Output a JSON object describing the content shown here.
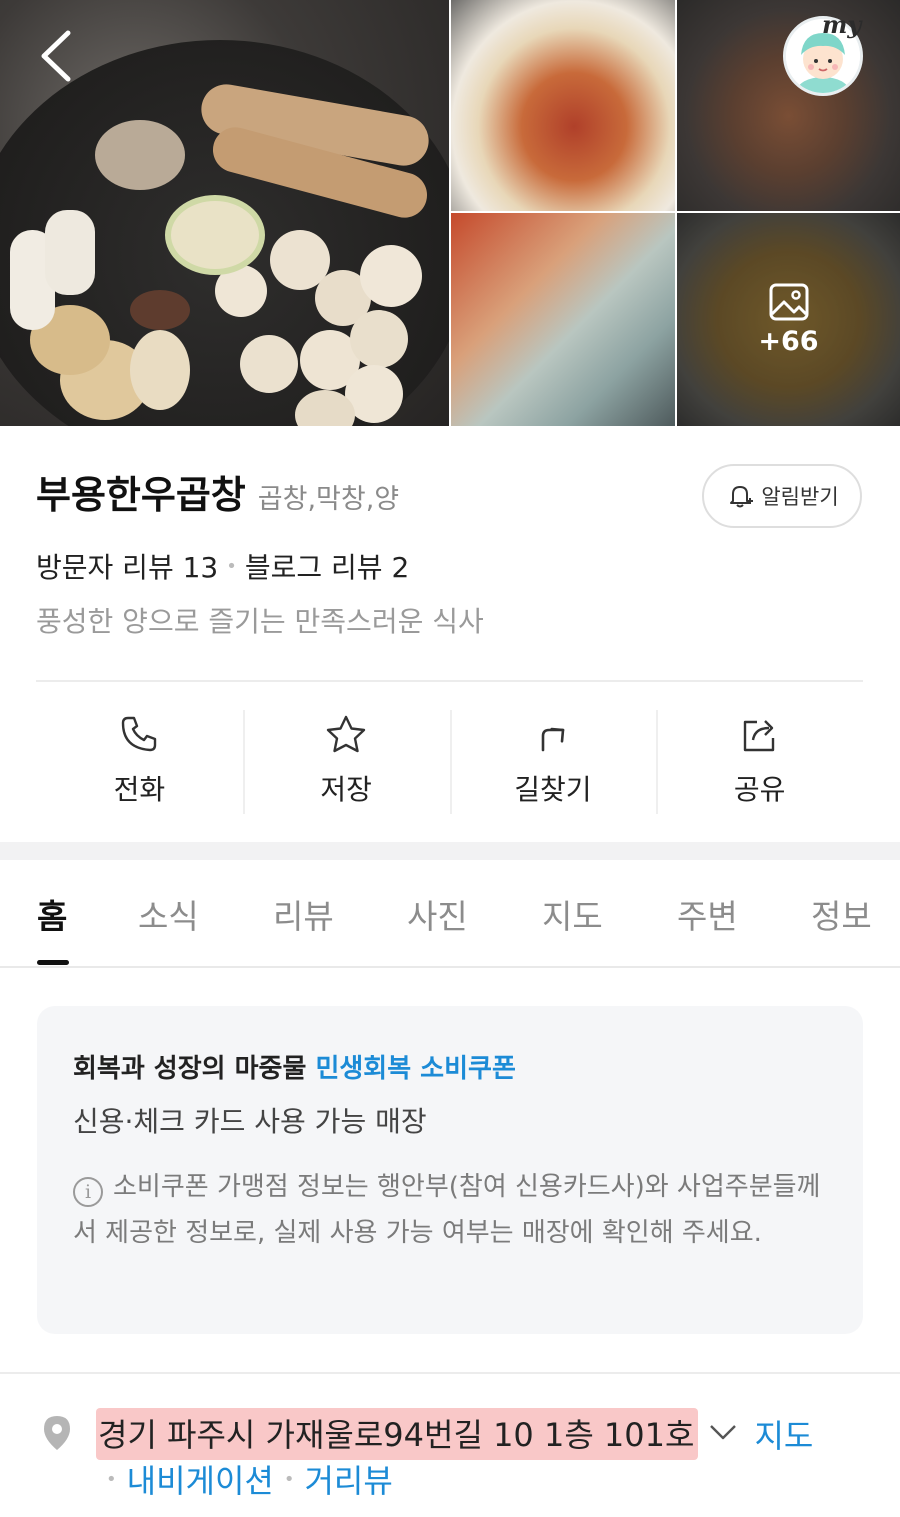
{
  "gallery": {
    "more_count": "+66",
    "avatar_badge": "my"
  },
  "place": {
    "name": "부용한우곱창",
    "category": "곱창,막창,양",
    "notify_label": "알림받기",
    "visitor_reviews": "방문자 리뷰 13",
    "blog_reviews": "블로그 리뷰 2",
    "tagline": "풍성한 양으로 즐기는 만족스러운 식사"
  },
  "actions": [
    {
      "label": "전화",
      "icon": "phone-icon"
    },
    {
      "label": "저장",
      "icon": "star-icon"
    },
    {
      "label": "길찾기",
      "icon": "directions-icon"
    },
    {
      "label": "공유",
      "icon": "share-icon"
    }
  ],
  "tabs": [
    "홈",
    "소식",
    "리뷰",
    "사진",
    "지도",
    "주변",
    "정보"
  ],
  "active_tab": "홈",
  "coupon": {
    "title_prefix": "회복과 성장의 마중물",
    "title_highlight": "민생회복 소비쿠폰",
    "subtitle": "신용·체크 카드 사용 가능 매장",
    "note": "소비쿠폰 가맹점 정보는 행안부(참여 신용카드사)와 사업주분들께서 제공한 정보로, 실제 사용 가능 여부는 매장에 확인해 주세요."
  },
  "address": {
    "text": "경기 파주시 가재울로94번길 10 1층 101호",
    "map_link": "지도",
    "navigation_link": "내비게이션",
    "streetview_link": "거리뷰"
  },
  "colors": {
    "accent_blue": "#1c8bd6",
    "address_highlight": "#f9c8c8"
  }
}
